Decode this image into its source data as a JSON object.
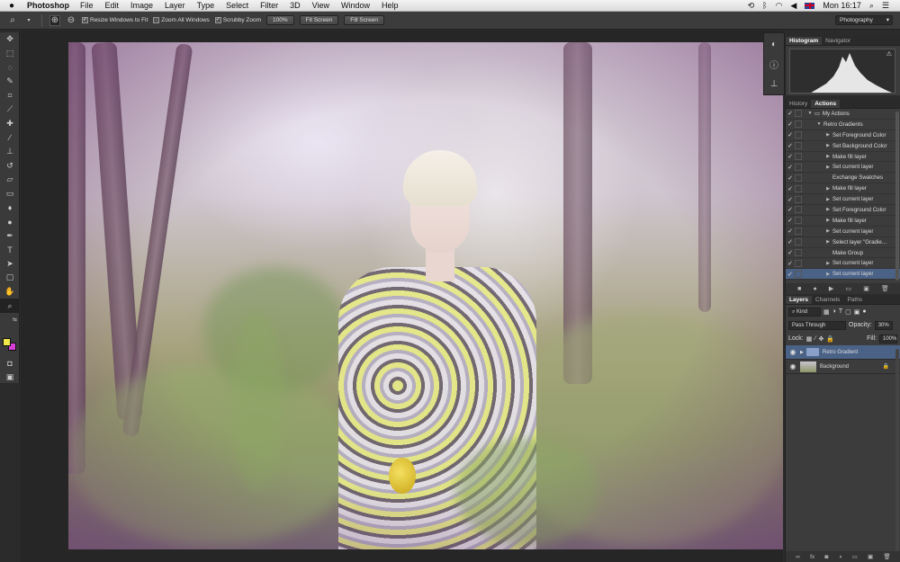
{
  "menubar": {
    "app_name": "Photoshop",
    "items": [
      "File",
      "Edit",
      "Image",
      "Layer",
      "Type",
      "Select",
      "Filter",
      "3D",
      "View",
      "Window",
      "Help"
    ],
    "clock": "Mon 16:17"
  },
  "options": {
    "resize_windows": "Resize Windows to Fit",
    "zoom_all": "Zoom All Windows",
    "scrubby_zoom": "Scrubby Zoom",
    "zoom_value": "100%",
    "fit_screen": "Fit Screen",
    "fill_screen": "Fill Screen",
    "workspace": "Photography"
  },
  "toolbar": {
    "tools": [
      "move-tool",
      "marquee-tool",
      "lasso-tool",
      "quick-select-tool",
      "crop-tool",
      "eyedropper-tool",
      "healing-tool",
      "brush-tool",
      "clone-stamp-tool",
      "history-brush-tool",
      "eraser-tool",
      "gradient-tool",
      "blur-tool",
      "dodge-tool",
      "pen-tool",
      "type-tool",
      "path-select-tool",
      "shape-tool",
      "hand-tool",
      "zoom-tool"
    ],
    "foreground_color": "#f0e84a",
    "background_color": "#d63ed6"
  },
  "histogram": {
    "tabs": [
      "Histogram",
      "Navigator"
    ]
  },
  "actions": {
    "tabs": [
      "History",
      "Actions"
    ],
    "rows": [
      {
        "label": "My Actions",
        "indent": 1,
        "folder": true
      },
      {
        "label": "Retro Gradients",
        "indent": 2
      },
      {
        "label": "Set Foreground Color",
        "indent": 3
      },
      {
        "label": "Set Background Color",
        "indent": 3
      },
      {
        "label": "Make fill layer",
        "indent": 3
      },
      {
        "label": "Set current layer",
        "indent": 3
      },
      {
        "label": "Exchange Swatches",
        "indent": 3,
        "noarrow": true
      },
      {
        "label": "Make fill layer",
        "indent": 3
      },
      {
        "label": "Set current layer",
        "indent": 3
      },
      {
        "label": "Set Foreground Color",
        "indent": 3
      },
      {
        "label": "Make fill layer",
        "indent": 3
      },
      {
        "label": "Set current layer",
        "indent": 3
      },
      {
        "label": "Select layer \"Gradie...",
        "indent": 3
      },
      {
        "label": "Make Group",
        "indent": 3,
        "noarrow": true
      },
      {
        "label": "Set current layer",
        "indent": 3
      },
      {
        "label": "Set current layer",
        "indent": 3,
        "selected": true
      }
    ]
  },
  "layers": {
    "tabs": [
      "Layers",
      "Channels",
      "Paths"
    ],
    "filter": "Kind",
    "blend_mode": "Pass Through",
    "opacity_label": "Opacity:",
    "opacity": "30%",
    "lock_label": "Lock:",
    "fill_label": "Fill:",
    "fill": "100%",
    "items": [
      {
        "name": "Retro Gradient",
        "type": "group",
        "selected": true
      },
      {
        "name": "Background",
        "type": "image",
        "locked": true
      }
    ]
  }
}
